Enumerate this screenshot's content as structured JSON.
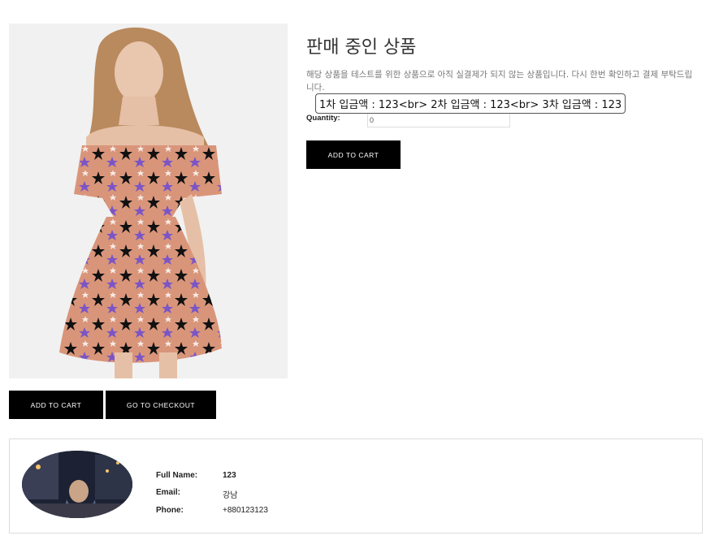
{
  "product": {
    "title": "판매 중인 상품",
    "description": "해당 상품을 테스트를 위한 상품으로 아직 실결제가 되지 않는 상품입니다. 다시 한번 확인하고 결제 부탁드립니다.",
    "tooltip": "1차 입금액 : 123<br> 2차 입금액 : 123<br> 3차 입금액 : 123",
    "quantity_label": "Quantity:",
    "quantity_value": "0",
    "add_to_cart": "ADD TO CART"
  },
  "actions": {
    "add_to_cart": "ADD TO CART",
    "checkout": "GO TO CHECKOUT"
  },
  "profile": {
    "full_name_label": "Full Name:",
    "full_name": "123",
    "email_label": "Email:",
    "email": "강남",
    "phone_label": "Phone:",
    "phone": "+880123123"
  },
  "colors": {
    "button_bg": "#000000",
    "dress_base": "#d9957a",
    "star_purple": "#7b55c6",
    "star_black": "#111111"
  },
  "icons": {
    "product_image": "model-in-star-print-dress",
    "avatar": "night-scene-avatar"
  }
}
